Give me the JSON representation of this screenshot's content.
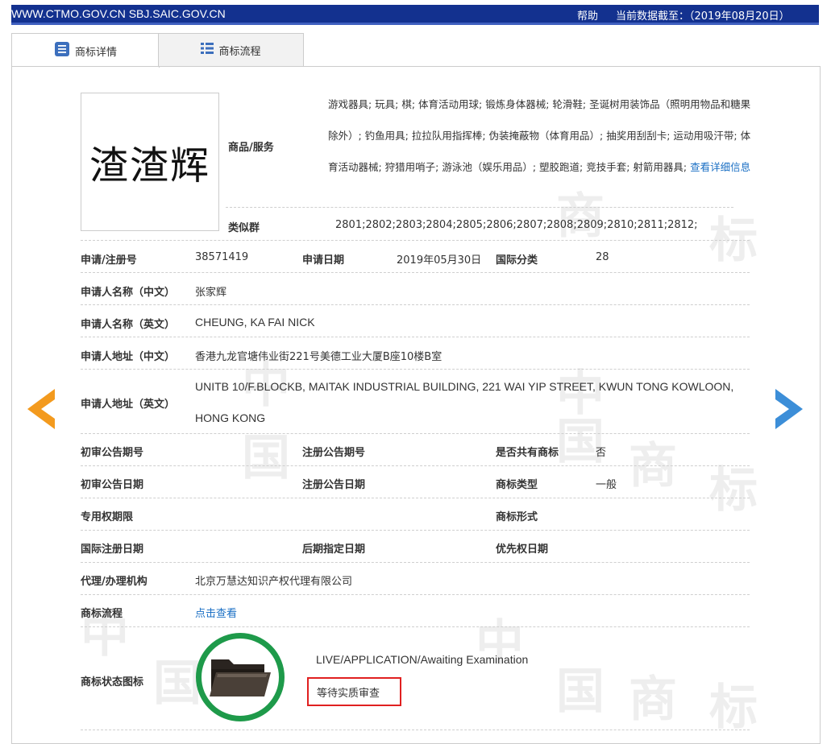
{
  "topbar": {
    "site": "WWW.CTMO.GOV.CN SBJ.SAIC.GOV.CN",
    "help": "帮助",
    "date_label": "当前数据截至：",
    "date_value": "（2019年08月20日）"
  },
  "tabs": {
    "details": "商标详情",
    "process": "商标流程"
  },
  "logo_text": "渣渣辉",
  "watermark_chars": [
    "中",
    "国",
    "商",
    "标"
  ],
  "goods": {
    "label": "商品/服务",
    "text": "游戏器具; 玩具; 棋; 体育活动用球; 锻炼身体器械; 轮滑鞋; 圣诞树用装饰品（照明用物品和糖果除外）; 钓鱼用具; 拉拉队用指挥棒; 伪装掩蔽物（体育用品）; 抽奖用刮刮卡; 运动用吸汗带; 体育活动器械; 狩猎用哨子; 游泳池（娱乐用品）; 塑胶跑道; 竞技手套; 射箭用器具;",
    "link": "查看详细信息"
  },
  "similar_group": {
    "label": "类似群",
    "value": "2801;2802;2803;2804;2805;2806;2807;2808;2809;2810;2811;2812;"
  },
  "fields": {
    "reg_no_label": "申请/注册号",
    "reg_no": "38571419",
    "apply_date_label": "申请日期",
    "apply_date": "2019年05月30日",
    "intl_class_label": "国际分类",
    "intl_class": "28",
    "applicant_cn_label": "申请人名称（中文）",
    "applicant_cn": "张家辉",
    "applicant_en_label": "申请人名称（英文）",
    "applicant_en": "CHEUNG, KA FAI NICK",
    "addr_cn_label": "申请人地址（中文）",
    "addr_cn": "香港九龙官塘伟业街221号美德工业大厦B座10楼B室",
    "addr_en_label": "申请人地址（英文）",
    "addr_en_line1": "UNITB 10/F.BLOCKB, MAITAK INDUSTRIAL BUILDING, 221 WAI YIP STREET, KWUN TONG KOWLOON,",
    "addr_en_line2": "HONG KONG",
    "prelim_no_label": "初审公告期号",
    "reg_pub_no_label": "注册公告期号",
    "shared_label": "是否共有商标",
    "shared": "否",
    "prelim_date_label": "初审公告日期",
    "reg_pub_date_label": "注册公告日期",
    "tm_type_label": "商标类型",
    "tm_type": "一般",
    "exclusive_label": "专用权期限",
    "tm_form_label": "商标形式",
    "intl_reg_date_label": "国际注册日期",
    "later_date_label": "后期指定日期",
    "priority_date_label": "优先权日期",
    "agent_label": "代理/办理机构",
    "agent": "北京万慧达知识产权代理有限公司",
    "process_label": "商标流程",
    "process_link": "点击查看",
    "status_icon_label": "商标状态图标",
    "status_en": "LIVE/APPLICATION/Awaiting Examination",
    "status_cn": "等待实质审查"
  },
  "colors": {
    "topbar": "#13318f",
    "link": "#1a6fc4",
    "arrow_left": "#f39a1e",
    "arrow_right": "#3c8ed8",
    "status_ring": "#1e9a4a",
    "highlight": "#e02020"
  }
}
